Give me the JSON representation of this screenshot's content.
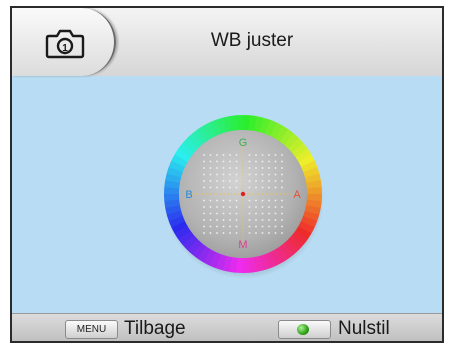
{
  "header": {
    "title": "WB juster",
    "camera_icon": "camera-icon"
  },
  "wheel": {
    "labels": {
      "top": "G",
      "left": "B",
      "right": "A",
      "bottom": "M"
    },
    "colors": {
      "G": "#3fae5c",
      "B": "#2a8ad6",
      "A": "#e0543a",
      "M": "#d2419a"
    },
    "cursor_color": "#e02020",
    "cursor_offset": {
      "ab": 0,
      "gm": 0
    }
  },
  "footer": {
    "menu_key": "MENU",
    "back_label": "Tilbage",
    "ok_key_icon": "green-button-icon",
    "reset_label": "Nulstil"
  }
}
